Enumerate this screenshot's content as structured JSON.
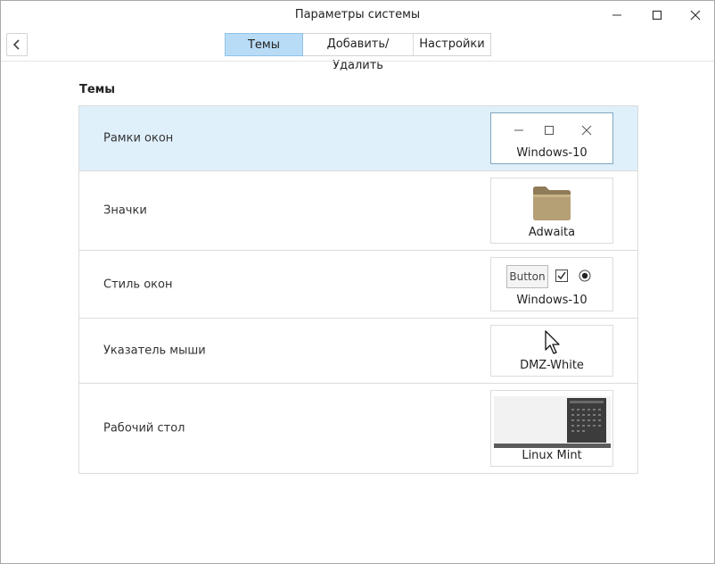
{
  "window": {
    "title": "Параметры системы"
  },
  "tabs": [
    {
      "label": "Темы",
      "active": true
    },
    {
      "label": "Добавить/Удалить",
      "active": false
    },
    {
      "label": "Настройки",
      "active": false
    }
  ],
  "section": {
    "title": "Темы"
  },
  "rows": [
    {
      "label": "Рамки окон",
      "value": "Windows-10",
      "selected": true
    },
    {
      "label": "Значки",
      "value": "Adwaita"
    },
    {
      "label": "Стиль окон",
      "value": "Windows-10",
      "sample_button": "Button"
    },
    {
      "label": "Указатель мыши",
      "value": "DMZ-White"
    },
    {
      "label": "Рабочий стол",
      "value": "Linux Mint"
    }
  ],
  "icons": {
    "back": "chevron-left-icon",
    "minimize": "minimize-icon",
    "maximize": "maximize-icon",
    "close": "close-icon",
    "folder": "folder-icon",
    "cursor": "mouse-pointer-icon"
  },
  "colors": {
    "selected_row": "#dff0fb",
    "active_tab": "#b9dcf6",
    "folder": "#b59f75"
  }
}
